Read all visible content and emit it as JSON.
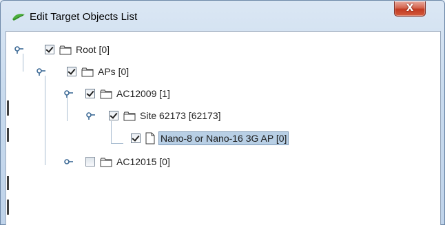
{
  "window": {
    "title": "Edit Target Objects List",
    "close_label": "X"
  },
  "tree": {
    "nodes": [
      {
        "label": "Root [0]",
        "checked": true,
        "icon": "folder-icon"
      },
      {
        "label": "APs [0]",
        "checked": true,
        "icon": "folder-icon"
      },
      {
        "label": "AC12009 [1]",
        "checked": true,
        "icon": "folder-icon"
      },
      {
        "label": "Site 62173 [62173]",
        "checked": true,
        "icon": "folder-icon"
      },
      {
        "label": "Nano-8 or Nano-16 3G AP [0]",
        "checked": true,
        "icon": "file-icon",
        "selected": true
      },
      {
        "label": "AC12015 [0]",
        "checked": false,
        "icon": "folder-icon"
      }
    ]
  }
}
